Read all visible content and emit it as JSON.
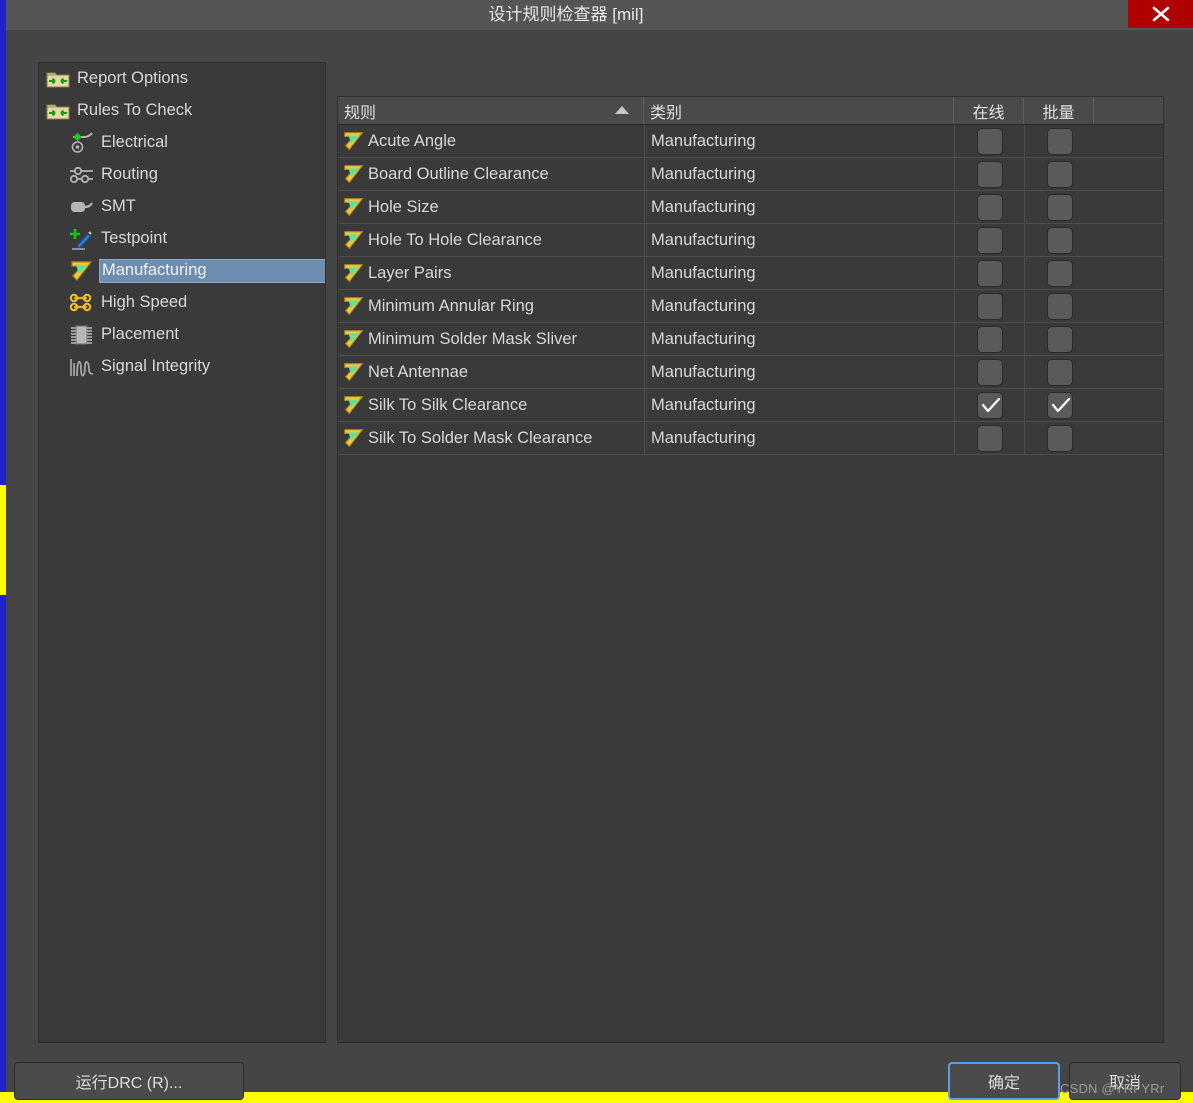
{
  "window": {
    "title": "设计规则检查器 [mil]",
    "close_label": "×",
    "close_icon": "close-icon"
  },
  "sidebar": {
    "items": [
      {
        "label": "Report Options",
        "icon": "folder-in-arrows-icon",
        "level": 0,
        "selected": false
      },
      {
        "label": "Rules To Check",
        "icon": "folder-in-arrows-icon",
        "level": 0,
        "selected": false
      },
      {
        "label": "Electrical",
        "icon": "electrical-icon",
        "level": 1,
        "selected": false
      },
      {
        "label": "Routing",
        "icon": "routing-icon",
        "level": 1,
        "selected": false
      },
      {
        "label": "SMT",
        "icon": "smt-icon",
        "level": 1,
        "selected": false
      },
      {
        "label": "Testpoint",
        "icon": "testpoint-icon",
        "level": 1,
        "selected": false
      },
      {
        "label": "Manufacturing",
        "icon": "manufacturing-icon",
        "level": 1,
        "selected": true
      },
      {
        "label": "High Speed",
        "icon": "high-speed-icon",
        "level": 1,
        "selected": false
      },
      {
        "label": "Placement",
        "icon": "placement-icon",
        "level": 1,
        "selected": false
      },
      {
        "label": "Signal Integrity",
        "icon": "signal-integrity-icon",
        "level": 1,
        "selected": false
      }
    ]
  },
  "rules_table": {
    "columns": [
      {
        "key": "rule",
        "label": "规则",
        "sorted": "asc"
      },
      {
        "key": "category",
        "label": "类别",
        "sorted": ""
      },
      {
        "key": "online",
        "label": "在线",
        "sorted": ""
      },
      {
        "key": "batch",
        "label": "批量",
        "sorted": ""
      }
    ],
    "rows": [
      {
        "rule": "Acute Angle",
        "category": "Manufacturing",
        "online": false,
        "batch": false
      },
      {
        "rule": "Board Outline Clearance",
        "category": "Manufacturing",
        "online": false,
        "batch": false
      },
      {
        "rule": "Hole Size",
        "category": "Manufacturing",
        "online": false,
        "batch": false
      },
      {
        "rule": "Hole To Hole Clearance",
        "category": "Manufacturing",
        "online": false,
        "batch": false
      },
      {
        "rule": "Layer Pairs",
        "category": "Manufacturing",
        "online": false,
        "batch": false
      },
      {
        "rule": "Minimum Annular Ring",
        "category": "Manufacturing",
        "online": false,
        "batch": false
      },
      {
        "rule": "Minimum Solder Mask Sliver",
        "category": "Manufacturing",
        "online": false,
        "batch": false
      },
      {
        "rule": "Net Antennae",
        "category": "Manufacturing",
        "online": false,
        "batch": false
      },
      {
        "rule": "Silk To Silk Clearance",
        "category": "Manufacturing",
        "online": true,
        "batch": true
      },
      {
        "rule": "Silk To Solder Mask Clearance",
        "category": "Manufacturing",
        "online": false,
        "batch": false
      }
    ]
  },
  "buttons": {
    "run_drc": "运行DRC (R)...",
    "ok": "确定",
    "cancel": "取消"
  },
  "watermark": "CSDN @YRr YRr",
  "colors": {
    "window_bg": "#454545",
    "panel_bg": "#3a3a3a",
    "titlebar_bg": "#555555",
    "close_red": "#b00000",
    "selection_blue": "#6f8db0",
    "focus_blue": "#5d9fe0",
    "accent_yellow": "#ffff00",
    "accent_blue": "#2222cc",
    "text": "#d8d8d8"
  }
}
